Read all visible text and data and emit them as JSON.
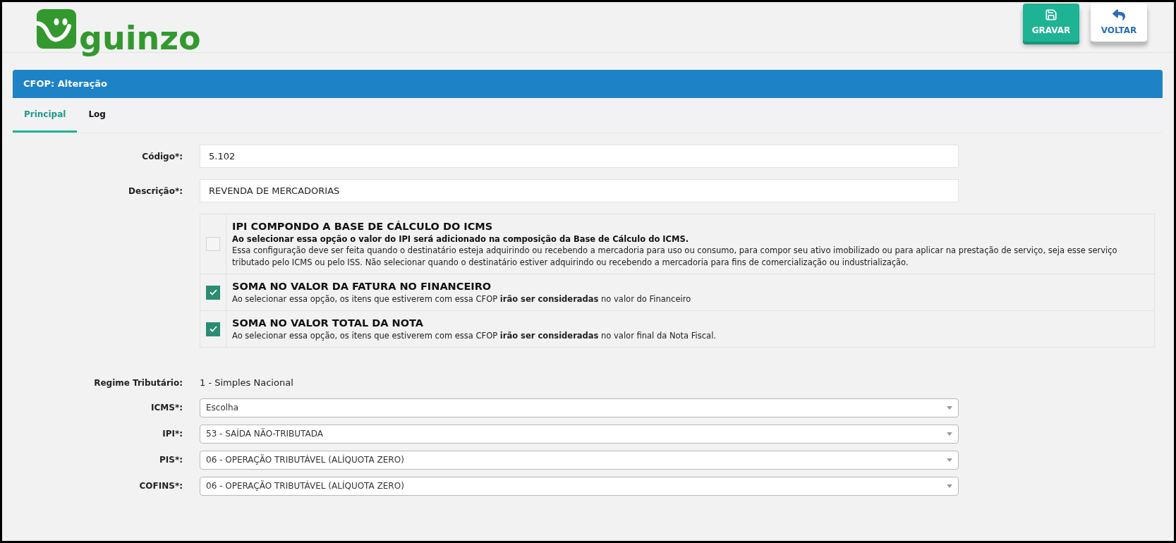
{
  "logo": {
    "text": "guinzo"
  },
  "buttons": [
    {
      "label": "GRAVAR",
      "kind": "save"
    },
    {
      "label": "VOLTAR",
      "kind": "back"
    }
  ],
  "panel": {
    "title": "CFOP: Alteração"
  },
  "tabs": [
    {
      "label": "Principal",
      "selected": true
    },
    {
      "label": "Log",
      "selected": false
    }
  ],
  "fields": [
    {
      "label": "Código*:",
      "value": "5.102"
    },
    {
      "label": "Descrição*:",
      "value": "REVENDA DE MERCADORIAS"
    }
  ],
  "options": [
    {
      "title": "IPI COMPONDO A BASE DE CÁLCULO DO ICMS",
      "note": "Ao selecionar essa opção o valor do IPI será adicionado na composição da Base de Cálculo do ICMS.",
      "text": "Essa configuração deve ser feita quando o destinatário esteja adquirindo ou recebendo a mercadoria para uso ou consumo, para compor seu ativo imobilizado ou para aplicar na prestação de serviço, seja esse serviço tributado pelo ICMS ou pelo ISS. Não selecionar quando o destinatário estiver adquirindo ou recebendo a mercadoria para fins de comercialização ou industrialização.",
      "checked": false
    },
    {
      "title": "SOMA NO VALOR DA FATURA NO FINANCEIRO",
      "text": "Ao selecionar essa opção, os itens que estiverem com essa CFOP **irão ser consideradas** no valor do Financeiro",
      "checked": true
    },
    {
      "title": "SOMA NO VALOR TOTAL DA NOTA",
      "text": "Ao selecionar essa opção, os itens que estiverem com essa CFOP **irão ser consideradas** no valor final da Nota Fiscal.",
      "checked": true
    }
  ],
  "regime": {
    "label": "Regime Tributário:",
    "value": "1 - Simples Nacional"
  },
  "selects": [
    {
      "label": "ICMS*:",
      "value": "Escolha"
    },
    {
      "label": "IPI*:",
      "value": "53 - SAÍDA NÃO-TRIBUTADA"
    },
    {
      "label": "PIS*:",
      "value": "06 - OPERAÇÃO TRIBUTÁVEL (ALÍQUOTA ZERO)"
    },
    {
      "label": "COFINS*:",
      "value": "06 - OPERAÇÃO TRIBUTÁVEL (ALÍQUOTA ZERO)"
    }
  ]
}
